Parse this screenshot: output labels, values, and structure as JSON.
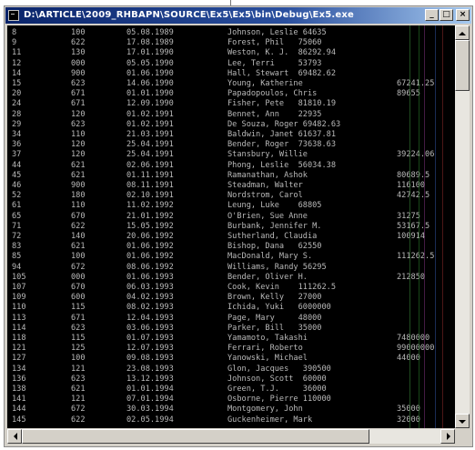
{
  "window": {
    "title": "D:\\ARTICLE\\2009_RHBAPN\\SOURCE\\Ex5\\Ex5\\bin\\Debug\\Ex5.exe",
    "buttons": {
      "minimize": "_",
      "maximize": "□",
      "close": "×"
    }
  },
  "console": {
    "text_color": "#b9b9b9",
    "rows": [
      [
        "8",
        "100",
        "05.08.1989",
        "Johnson, Leslie 64635",
        ""
      ],
      [
        "9",
        "622",
        "17.08.1989",
        "Forest, Phil   75060",
        ""
      ],
      [
        "11",
        "130",
        "17.01.1990",
        "Weston, K. J.  86292.94",
        ""
      ],
      [
        "12",
        "000",
        "05.05.1990",
        "Lee, Terri     53793",
        ""
      ],
      [
        "14",
        "900",
        "01.06.1990",
        "Hall, Stewart  69482.62",
        ""
      ],
      [
        "15",
        "623",
        "14.06.1990",
        "Young, Katherine",
        "67241.25"
      ],
      [
        "20",
        "671",
        "01.01.1990",
        "Papadopoulos, Chris",
        "89655"
      ],
      [
        "24",
        "671",
        "12.09.1990",
        "Fisher, Pete   81810.19",
        ""
      ],
      [
        "28",
        "120",
        "01.02.1991",
        "Bennet, Ann    22935",
        ""
      ],
      [
        "29",
        "623",
        "01.02.1991",
        "De Souza, Roger 69482.63",
        ""
      ],
      [
        "34",
        "110",
        "21.03.1991",
        "Baldwin, Janet 61637.81",
        ""
      ],
      [
        "36",
        "120",
        "25.04.1991",
        "Bender, Roger  73638.63",
        ""
      ],
      [
        "37",
        "120",
        "25.04.1991",
        "Stansbury, Willie",
        "39224.06"
      ],
      [
        "44",
        "621",
        "02.06.1991",
        "Phong, Leslie  56034.38",
        ""
      ],
      [
        "45",
        "621",
        "01.11.1991",
        "Ramanathan, Ashok",
        "80689.5"
      ],
      [
        "46",
        "900",
        "08.11.1991",
        "Steadman, Walter",
        "116100"
      ],
      [
        "52",
        "180",
        "02.10.1991",
        "Nordstrom, Carol",
        "42742.5"
      ],
      [
        "61",
        "110",
        "11.02.1992",
        "Leung, Luke    68805",
        ""
      ],
      [
        "65",
        "670",
        "21.01.1992",
        "O'Brien, Sue Anne",
        "31275"
      ],
      [
        "71",
        "622",
        "15.05.1992",
        "Burbank, Jennifer M.",
        "53167.5"
      ],
      [
        "72",
        "140",
        "20.06.1992",
        "Sutherland, Claudia",
        "100914"
      ],
      [
        "83",
        "621",
        "01.06.1992",
        "Bishop, Dana   62550",
        ""
      ],
      [
        "85",
        "100",
        "01.06.1992",
        "MacDonald, Mary S.",
        "111262.5"
      ],
      [
        "94",
        "672",
        "08.06.1992",
        "Williams, Randy 56295",
        ""
      ],
      [
        "105",
        "000",
        "01.06.1993",
        "Bender, Oliver H.",
        "212850"
      ],
      [
        "107",
        "670",
        "06.03.1993",
        "Cook, Kevin    111262.5",
        ""
      ],
      [
        "109",
        "600",
        "04.02.1993",
        "Brown, Kelly   27000",
        ""
      ],
      [
        "110",
        "115",
        "08.02.1993",
        "Ichida, Yuki   6000000",
        ""
      ],
      [
        "113",
        "671",
        "12.04.1993",
        "Page, Mary     48000",
        ""
      ],
      [
        "114",
        "623",
        "03.06.1993",
        "Parker, Bill   35000",
        ""
      ],
      [
        "118",
        "115",
        "01.07.1993",
        "Yamamoto, Takashi",
        "7480000"
      ],
      [
        "121",
        "125",
        "12.07.1993",
        "Ferrari, Roberto",
        "99000000"
      ],
      [
        "127",
        "100",
        "09.08.1993",
        "Yanowski, Michael",
        "44000"
      ],
      [
        "134",
        "121",
        "23.08.1993",
        "Glon, Jacques   390500",
        ""
      ],
      [
        "136",
        "623",
        "13.12.1993",
        "Johnson, Scott  60000",
        ""
      ],
      [
        "138",
        "621",
        "01.01.1994",
        "Green, T.J.     36000",
        ""
      ],
      [
        "141",
        "121",
        "07.01.1994",
        "Osborne, Pierre 110000",
        ""
      ],
      [
        "144",
        "672",
        "30.03.1994",
        "Montgomery, John",
        "35000"
      ],
      [
        "145",
        "622",
        "02.05.1994",
        "Guckenheimer, Mark",
        "32000"
      ]
    ]
  },
  "colors": {
    "titlebar_left": "#0a246a",
    "titlebar_right": "#a6caf0",
    "stripe_colors": [
      "#3c8c3c",
      "#2b7f2b",
      "#7a2f7a",
      "#2f4f9a",
      "#8a2a2a"
    ]
  }
}
